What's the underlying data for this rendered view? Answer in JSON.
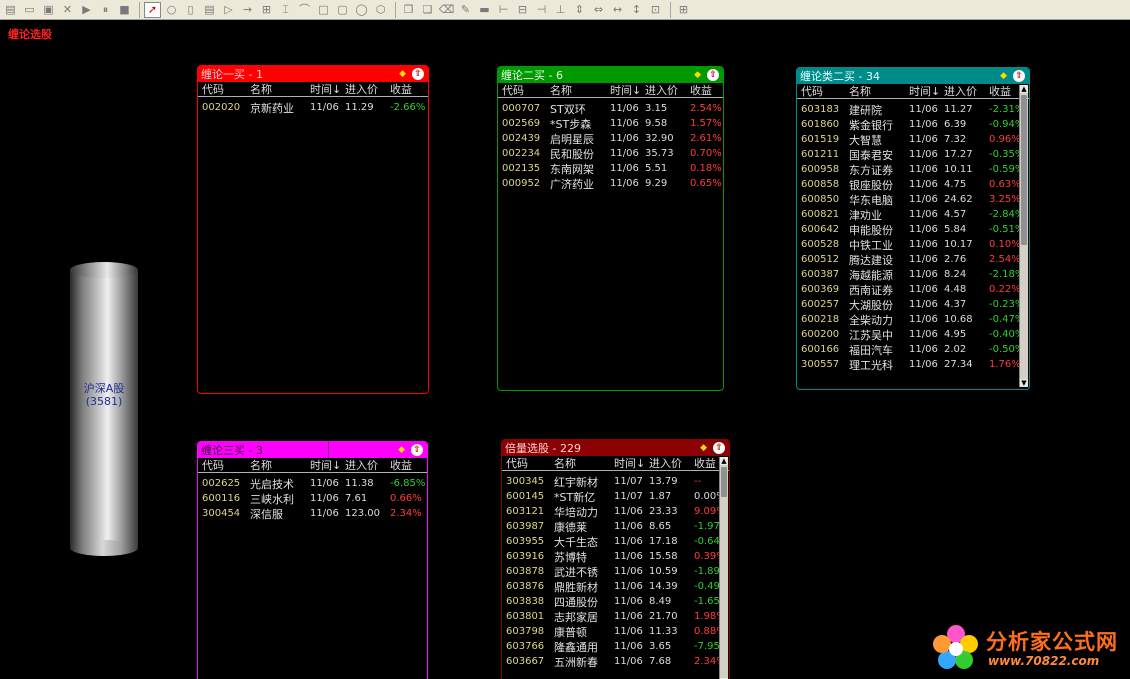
{
  "window": {
    "title": "缠论选股"
  },
  "toolbar": {
    "groups": [
      [
        "page-icon",
        "folder-icon",
        "save-icon",
        "close-icon",
        "play-icon",
        "pause-icon",
        "stop-icon"
      ],
      [
        "pointer-icon",
        "circle-icon",
        "rect-icon",
        "blank-icon",
        "triangle-icon",
        "arrow-icon",
        "split-icon",
        "line-icon",
        "shape-icon",
        "square-icon",
        "rounded-icon",
        "oval-icon",
        "hex-icon"
      ],
      [
        "copy-icon",
        "paste-icon",
        "delete-icon",
        "paint-icon",
        "align-top-icon",
        "align-left-icon",
        "align-center-icon",
        "align-right-icon",
        "align-bottom-icon",
        "distribute-v-icon",
        "distribute-h-icon",
        "same-width-icon",
        "same-height-icon",
        "same-size-icon"
      ],
      [
        "grid-icon"
      ]
    ]
  },
  "cylinder": {
    "label": "沪深A股",
    "count": "(3581)"
  },
  "columns": {
    "code": "代码",
    "name": "名称",
    "time": "时间↓",
    "price": "进入价",
    "ret": "收益"
  },
  "panels": {
    "p1": {
      "title": "缠论一买 - 1",
      "color": "#ff0000",
      "rows": [
        {
          "code": "002020",
          "name": "京新药业",
          "time": "11/06",
          "price": "11.29",
          "ret": "-2.66%",
          "sign": "neg"
        }
      ]
    },
    "p2": {
      "title": "缠论二买 - 6",
      "color": "#009900",
      "rows": [
        {
          "code": "000707",
          "name": "ST双环",
          "time": "11/06",
          "price": "3.15",
          "ret": "2.54%",
          "sign": "pos"
        },
        {
          "code": "002569",
          "name": "*ST步森",
          "time": "11/06",
          "price": "9.58",
          "ret": "1.57%",
          "sign": "pos"
        },
        {
          "code": "002439",
          "name": "启明星辰",
          "time": "11/06",
          "price": "32.90",
          "ret": "2.61%",
          "sign": "pos"
        },
        {
          "code": "002234",
          "name": "民和股份",
          "time": "11/06",
          "price": "35.73",
          "ret": "0.70%",
          "sign": "pos"
        },
        {
          "code": "002135",
          "name": "东南网架",
          "time": "11/06",
          "price": "5.51",
          "ret": "0.18%",
          "sign": "pos"
        },
        {
          "code": "000952",
          "name": "广济药业",
          "time": "11/06",
          "price": "9.29",
          "ret": "0.65%",
          "sign": "pos"
        }
      ]
    },
    "p3": {
      "title": "缠论类二买 - 34",
      "color": "#008b8b",
      "rows": [
        {
          "code": "603183",
          "name": "建研院",
          "time": "11/06",
          "price": "11.27",
          "ret": "-2.31%",
          "sign": "neg"
        },
        {
          "code": "601860",
          "name": "紫金银行",
          "time": "11/06",
          "price": "6.39",
          "ret": "-0.94%",
          "sign": "neg"
        },
        {
          "code": "601519",
          "name": "大智慧",
          "time": "11/06",
          "price": "7.32",
          "ret": "0.96%",
          "sign": "pos"
        },
        {
          "code": "601211",
          "name": "国泰君安",
          "time": "11/06",
          "price": "17.27",
          "ret": "-0.35%",
          "sign": "neg"
        },
        {
          "code": "600958",
          "name": "东方证券",
          "time": "11/06",
          "price": "10.11",
          "ret": "-0.59%",
          "sign": "neg"
        },
        {
          "code": "600858",
          "name": "银座股份",
          "time": "11/06",
          "price": "4.75",
          "ret": "0.63%",
          "sign": "pos"
        },
        {
          "code": "600850",
          "name": "华东电脑",
          "time": "11/06",
          "price": "24.62",
          "ret": "3.25%",
          "sign": "pos"
        },
        {
          "code": "600821",
          "name": "津劝业",
          "time": "11/06",
          "price": "4.57",
          "ret": "-2.84%",
          "sign": "neg"
        },
        {
          "code": "600642",
          "name": "申能股份",
          "time": "11/06",
          "price": "5.84",
          "ret": "-0.51%",
          "sign": "neg"
        },
        {
          "code": "600528",
          "name": "中铁工业",
          "time": "11/06",
          "price": "10.17",
          "ret": "0.10%",
          "sign": "pos"
        },
        {
          "code": "600512",
          "name": "腾达建设",
          "time": "11/06",
          "price": "2.76",
          "ret": "2.54%",
          "sign": "pos"
        },
        {
          "code": "600387",
          "name": "海越能源",
          "time": "11/06",
          "price": "8.24",
          "ret": "-2.18%",
          "sign": "neg"
        },
        {
          "code": "600369",
          "name": "西南证券",
          "time": "11/06",
          "price": "4.48",
          "ret": "0.22%",
          "sign": "pos"
        },
        {
          "code": "600257",
          "name": "大湖股份",
          "time": "11/06",
          "price": "4.37",
          "ret": "-0.23%",
          "sign": "neg"
        },
        {
          "code": "600218",
          "name": "全柴动力",
          "time": "11/06",
          "price": "10.68",
          "ret": "-0.47%",
          "sign": "neg"
        },
        {
          "code": "600200",
          "name": "江苏吴中",
          "time": "11/06",
          "price": "4.95",
          "ret": "-0.40%",
          "sign": "neg"
        },
        {
          "code": "600166",
          "name": "福田汽车",
          "time": "11/06",
          "price": "2.02",
          "ret": "-0.50%",
          "sign": "neg"
        },
        {
          "code": "300557",
          "name": "理工光科",
          "time": "11/06",
          "price": "27.34",
          "ret": "1.76%",
          "sign": "pos"
        }
      ]
    },
    "p4": {
      "title": "缠论三买 - 3",
      "color": "#ff00ff",
      "rows": [
        {
          "code": "002625",
          "name": "光启技术",
          "time": "11/06",
          "price": "11.38",
          "ret": "-6.85%",
          "sign": "neg"
        },
        {
          "code": "600116",
          "name": "三峡水利",
          "time": "11/06",
          "price": "7.61",
          "ret": "0.66%",
          "sign": "pos"
        },
        {
          "code": "300454",
          "name": "深信服",
          "time": "11/06",
          "price": "123.00",
          "ret": "2.34%",
          "sign": "pos"
        }
      ]
    },
    "p5": {
      "title": "倍量选股 - 229",
      "color": "#8b0000",
      "rows": [
        {
          "code": "300345",
          "name": "红宇新材",
          "time": "11/07",
          "price": "13.79",
          "ret": "--",
          "sign": "pos"
        },
        {
          "code": "600145",
          "name": "*ST新亿",
          "time": "11/07",
          "price": "1.87",
          "ret": "0.00%",
          "sign": "neu"
        },
        {
          "code": "603121",
          "name": "华培动力",
          "time": "11/06",
          "price": "23.33",
          "ret": "9.09%",
          "sign": "pos"
        },
        {
          "code": "603987",
          "name": "康德莱",
          "time": "11/06",
          "price": "8.65",
          "ret": "-1.97%",
          "sign": "neg"
        },
        {
          "code": "603955",
          "name": "大千生态",
          "time": "11/06",
          "price": "17.18",
          "ret": "-0.64%",
          "sign": "neg"
        },
        {
          "code": "603916",
          "name": "苏博特",
          "time": "11/06",
          "price": "15.58",
          "ret": "0.39%",
          "sign": "pos"
        },
        {
          "code": "603878",
          "name": "武进不锈",
          "time": "11/06",
          "price": "10.59",
          "ret": "-1.89%",
          "sign": "neg"
        },
        {
          "code": "603876",
          "name": "鼎胜新材",
          "time": "11/06",
          "price": "14.39",
          "ret": "-0.49%",
          "sign": "neg"
        },
        {
          "code": "603838",
          "name": "四通股份",
          "time": "11/06",
          "price": "8.49",
          "ret": "-1.65%",
          "sign": "neg"
        },
        {
          "code": "603801",
          "name": "志邦家居",
          "time": "11/06",
          "price": "21.70",
          "ret": "1.98%",
          "sign": "pos"
        },
        {
          "code": "603798",
          "name": "康普顿",
          "time": "11/06",
          "price": "11.33",
          "ret": "0.88%",
          "sign": "pos"
        },
        {
          "code": "603766",
          "name": "隆鑫通用",
          "time": "11/06",
          "price": "3.65",
          "ret": "-7.95%",
          "sign": "neg"
        },
        {
          "code": "603667",
          "name": "五洲新春",
          "time": "11/06",
          "price": "7.68",
          "ret": "2.34%",
          "sign": "pos"
        }
      ]
    }
  },
  "watermark": {
    "text": "分析家公式网",
    "url": "www.70822.com"
  }
}
